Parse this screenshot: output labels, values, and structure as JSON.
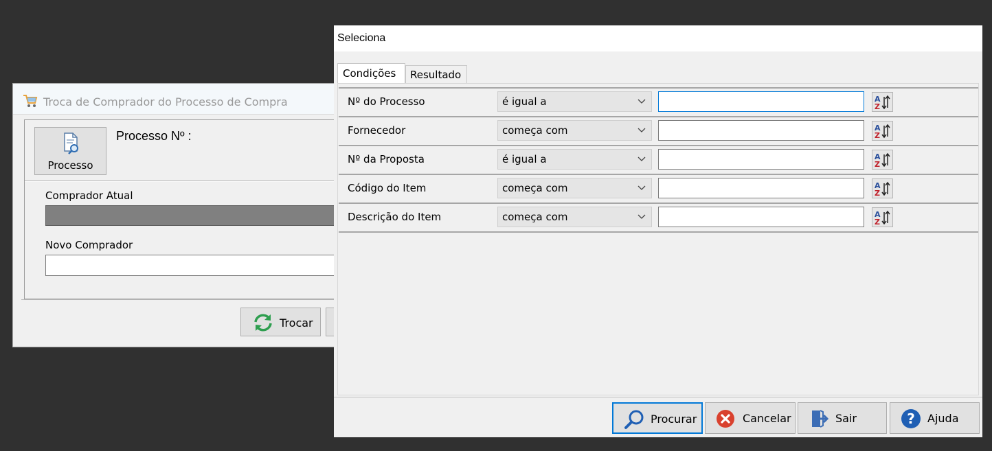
{
  "background_window": {
    "title": "Troca de Comprador do Processo de Compra",
    "process_button_label": "Processo",
    "process_number_label": "Processo Nº :",
    "current_buyer_label": "Comprador Atual",
    "new_buyer_label": "Novo Comprador",
    "swap_button_label": "Trocar"
  },
  "dialog": {
    "title": "Seleciona",
    "tabs": [
      {
        "label": "Condições",
        "active": true
      },
      {
        "label": "Resultado",
        "active": false
      }
    ],
    "conditions": [
      {
        "field": "Nº do Processo",
        "operator": "é igual a",
        "value": ""
      },
      {
        "field": "Fornecedor",
        "operator": "começa com",
        "value": ""
      },
      {
        "field": "Nº da Proposta",
        "operator": "é igual a",
        "value": ""
      },
      {
        "field": "Código do Item",
        "operator": "começa com",
        "value": ""
      },
      {
        "field": "Descrição do Item",
        "operator": "começa com",
        "value": ""
      }
    ],
    "buttons": {
      "search": "Procurar",
      "cancel": "Cancelar",
      "exit": "Sair",
      "help": "Ajuda"
    }
  },
  "icons": {
    "cart": "shopping-cart-icon",
    "document_search": "document-search-icon",
    "refresh": "refresh-icon",
    "sort": "sort-az-icon",
    "search": "magnifier-icon",
    "cancel": "cancel-x-icon",
    "exit": "exit-door-icon",
    "help": "help-question-icon"
  },
  "colors": {
    "desktop": "#303030",
    "accent": "#0078d7",
    "refresh_green": "#2e9e4f",
    "cancel_red": "#d9412e",
    "help_blue": "#1f5fb4",
    "sort_red": "#c0202a"
  }
}
